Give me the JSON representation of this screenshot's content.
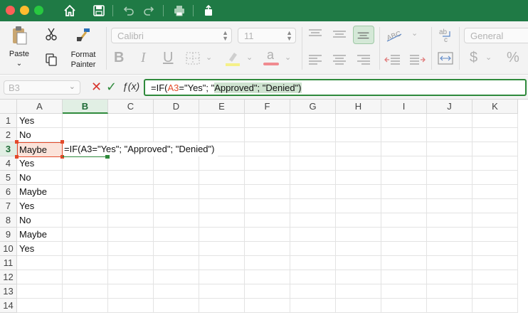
{
  "colors": {
    "titlebar": "#1f7a45",
    "accent": "#2f8a3c",
    "ref": "#e34a2a"
  },
  "title_toolbar": {
    "icons": [
      "home-icon",
      "save-icon",
      "undo-icon",
      "redo-icon",
      "print-icon",
      "share-icon"
    ]
  },
  "ribbon": {
    "paste_label": "Paste",
    "format_painter_label": "Format\nPainter",
    "font_name": "Calibri",
    "font_size": "11",
    "bold_label": "B",
    "italic_label": "I",
    "underline_label": "U",
    "number_format": "General",
    "currency_label": "$",
    "percent_label": "%"
  },
  "formula_bar": {
    "name_box": "B3",
    "fx_label": "ƒ(x)",
    "formula_parts": [
      "=IF(",
      "A3",
      "=\"Yes\"; \"",
      "Approved\"; \"Denied\")"
    ]
  },
  "sheet": {
    "columns": [
      "A",
      "B",
      "C",
      "D",
      "E",
      "F",
      "G",
      "H",
      "I",
      "J",
      "K"
    ],
    "active_column": "B",
    "rows": [
      "1",
      "2",
      "3",
      "4",
      "5",
      "6",
      "7",
      "8",
      "9",
      "10",
      "11",
      "12",
      "13",
      "14"
    ],
    "active_row": "3",
    "column_a_values": [
      "Yes",
      "No",
      "Maybe",
      "Yes",
      "No",
      "Maybe",
      "Yes",
      "No",
      "Maybe",
      "Yes"
    ],
    "b3_content": "=IF(A3=\"Yes\"; \"Approved\"; \"Denied\")"
  }
}
